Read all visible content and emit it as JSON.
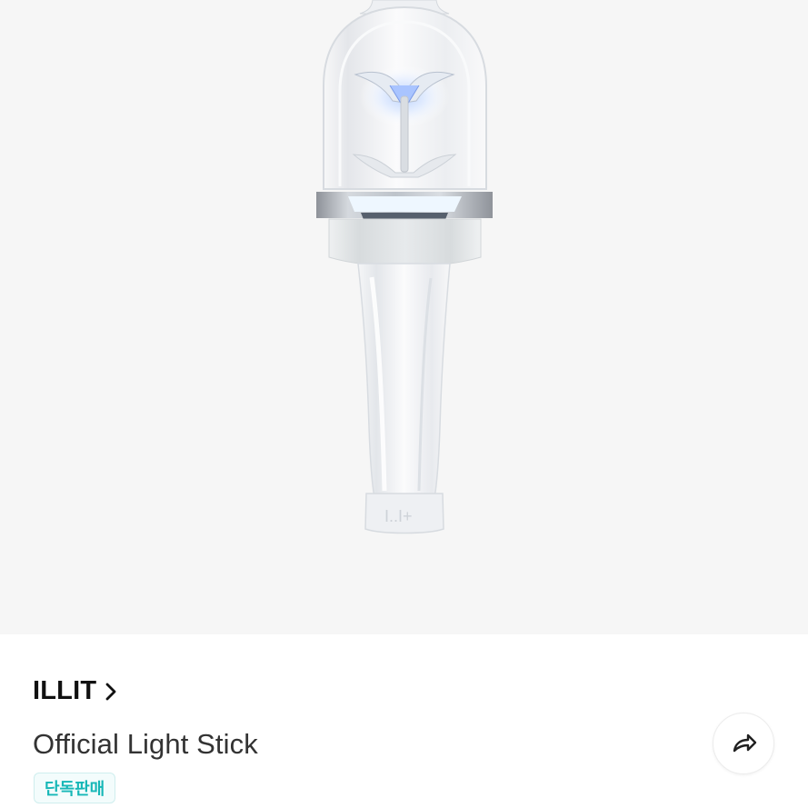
{
  "product": {
    "artist": "ILLIT",
    "title": "Official Light Stick",
    "badge": "단독판매",
    "image_subject": "light stick product image"
  },
  "icons": {
    "artist_arrow": "chevron-right-icon",
    "share": "share-arrow-icon"
  },
  "colors": {
    "hero_background": "#f6f6f6",
    "badge_text": "#16b7b7",
    "badge_border": "#cfeeee",
    "badge_background": "#f3fcfc",
    "artist_text": "#111111",
    "title_text": "#333333"
  }
}
